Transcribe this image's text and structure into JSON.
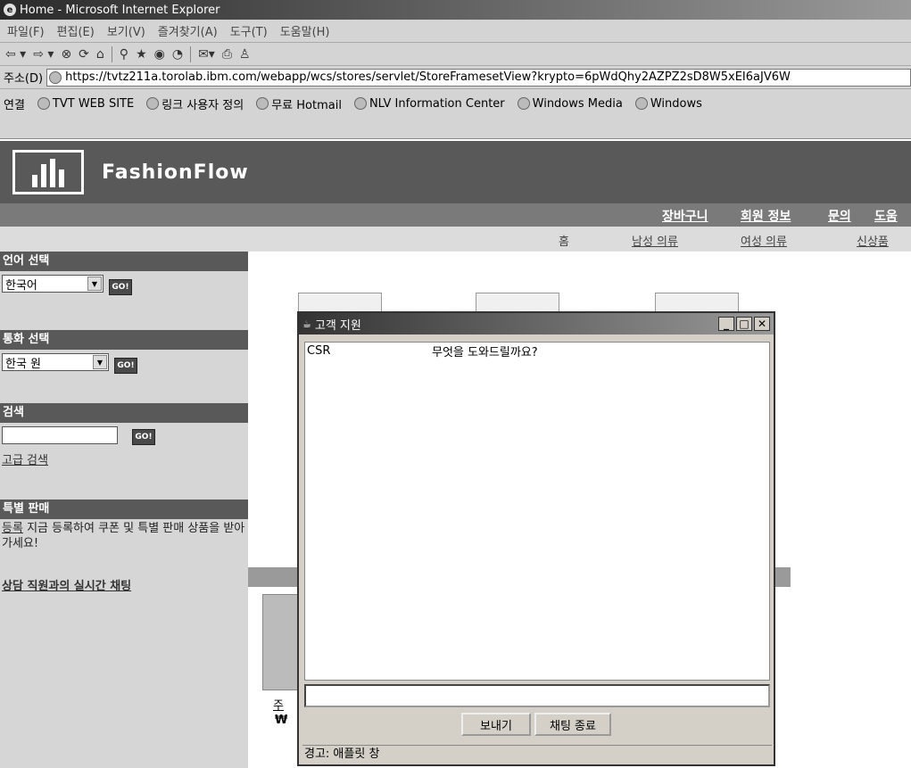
{
  "browser": {
    "title": "Home - Microsoft Internet Explorer",
    "menu": [
      "파일(F)",
      "편집(E)",
      "보기(V)",
      "즐겨찾기(A)",
      "도구(T)",
      "도움말(H)"
    ],
    "address_label": "주소(D)",
    "address_url": "https://tvtz211a.torolab.ibm.com/webapp/wcs/stores/servlet/StoreFramesetView?krypto=6pWdQhy2AZPZ2sD8W5xEI6aJV6W",
    "links_label": "연결",
    "links": [
      "TVT WEB SITE",
      "링크 사용자 정의",
      "무료 Hotmail",
      "NLV Information Center",
      "Windows Media",
      "Windows"
    ]
  },
  "site": {
    "brand": "FashionFlow",
    "nav_top": [
      "장바구니",
      "회원 정보",
      "문의",
      "도움"
    ],
    "nav_sub": [
      "홈",
      "남성 의류",
      "여성 의류",
      "신상품"
    ]
  },
  "sidebar": {
    "language": {
      "title": "언어 선택",
      "value": "한국어",
      "go": "GO!"
    },
    "currency": {
      "title": "통화 선택",
      "value": "한국 원",
      "go": "GO!"
    },
    "search": {
      "title": "검색",
      "go": "GO!",
      "advanced": "고급 검색"
    },
    "special": {
      "title": "특별 판매",
      "link": "등록",
      "text": "지금 등록하여 쿠폰 및 특별 판매 상품을 받아가세요!"
    },
    "chat_link": "상담 직원과의 실시간 채팅"
  },
  "content": {
    "product_label": "주",
    "currency_symbol": "₩"
  },
  "dialog": {
    "title": "고객 지원",
    "messages": [
      {
        "sender": "CSR",
        "text": "무엇을 도와드릴까요?"
      }
    ],
    "send": "보내기",
    "end_chat": "채팅 종료",
    "status": "경고: 애플릿 창"
  }
}
